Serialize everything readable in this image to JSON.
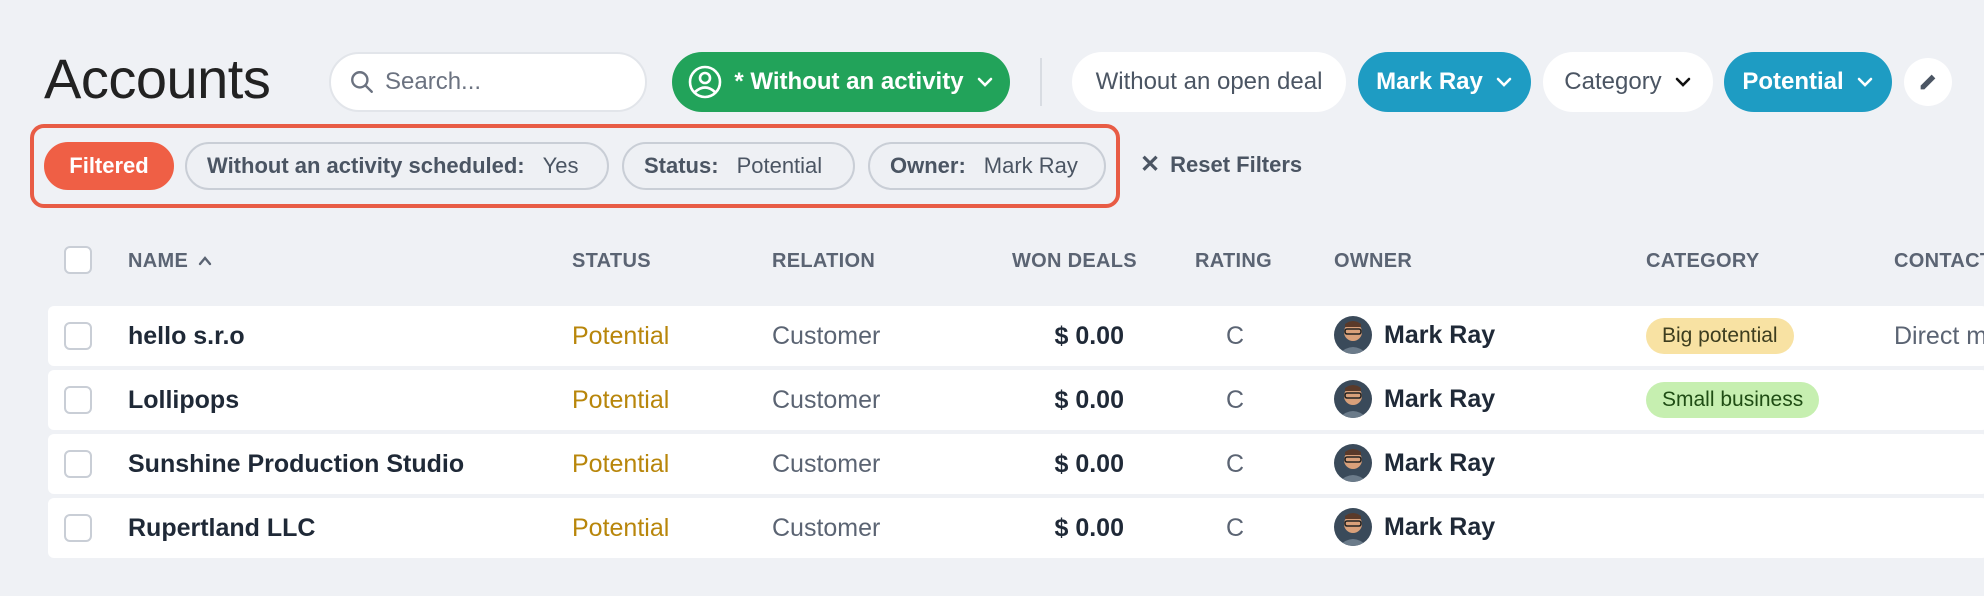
{
  "header": {
    "title": "Accounts"
  },
  "search": {
    "placeholder": "Search..."
  },
  "toolbar": {
    "activity_filter": "* Without an activity",
    "deal_filter": "Without an open deal",
    "owner_filter": "Mark Ray",
    "category_filter": "Category",
    "status_filter": "Potential"
  },
  "filters": {
    "badge": "Filtered",
    "chips": [
      {
        "key": "Without an activity scheduled:",
        "value": "Yes"
      },
      {
        "key": "Status:",
        "value": "Potential"
      },
      {
        "key": "Owner:",
        "value": "Mark Ray"
      }
    ],
    "reset_label": "Reset Filters"
  },
  "table": {
    "columns": [
      "NAME",
      "STATUS",
      "RELATION",
      "WON DEALS",
      "RATING",
      "OWNER",
      "CATEGORY",
      "CONTACT"
    ],
    "sort_indicator": "^",
    "rows": [
      {
        "name": "hello s.r.o",
        "status": "Potential",
        "relation": "Customer",
        "won_deals": "$ 0.00",
        "rating": "C",
        "owner": "Mark Ray",
        "category": "Big potential",
        "contact": "Direct m"
      },
      {
        "name": "Lollipops",
        "status": "Potential",
        "relation": "Customer",
        "won_deals": "$ 0.00",
        "rating": "C",
        "owner": "Mark Ray",
        "category": "Small business",
        "contact": ""
      },
      {
        "name": "Sunshine Production Studio",
        "status": "Potential",
        "relation": "Customer",
        "won_deals": "$ 0.00",
        "rating": "C",
        "owner": "Mark Ray",
        "category": "",
        "contact": ""
      },
      {
        "name": "Rupertland LLC",
        "status": "Potential",
        "relation": "Customer",
        "won_deals": "$ 0.00",
        "rating": "C",
        "owner": "Mark Ray",
        "category": "",
        "contact": ""
      }
    ]
  },
  "colors": {
    "activity_green": "#22a35a",
    "filter_blue": "#1e9cc3",
    "filtered_red": "#ef5f45",
    "status_potential": "#b8860b",
    "badge_big_potential": "#f8e2a3",
    "badge_small_business": "#c6efb0"
  },
  "icons": [
    "search-icon",
    "user-circle-icon",
    "chevron-down-icon",
    "pencil-icon",
    "close-icon",
    "sort-up-icon",
    "avatar"
  ]
}
